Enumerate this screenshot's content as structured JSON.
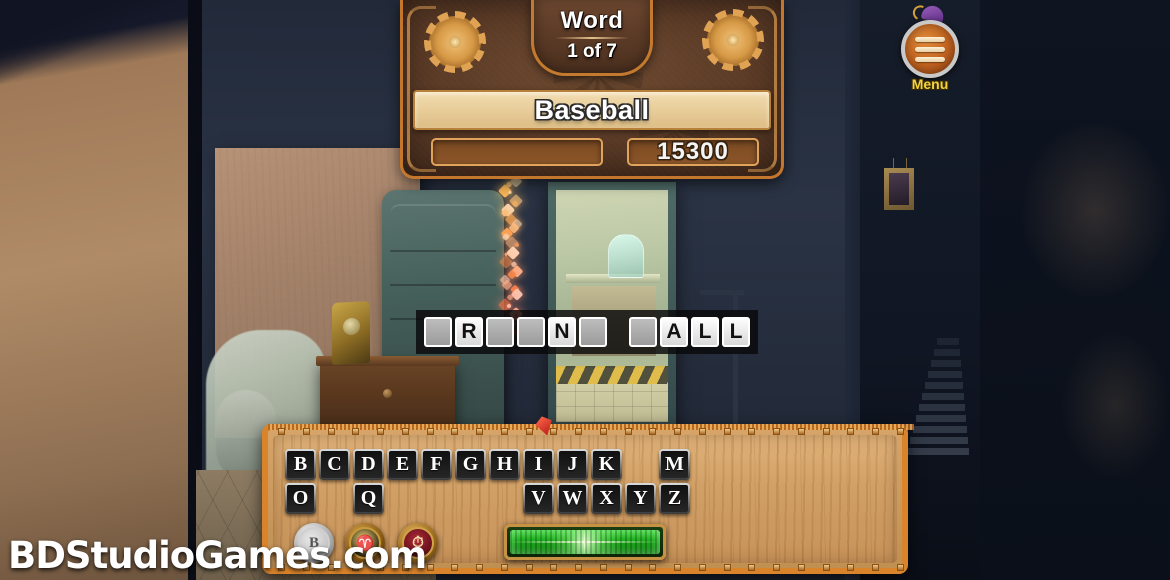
{
  "hud": {
    "word_title": "Word",
    "word_count": "1 of 7",
    "current_word": "Baseball",
    "score": "15300",
    "progress_percent": 0,
    "gear_left_icon": "gear-icon",
    "gear_right_icon": "gear-icon"
  },
  "menu": {
    "label": "Menu",
    "icon": "hamburger-menu-icon",
    "cap_icon": "wizard-hat-icon"
  },
  "answer": {
    "slots": [
      {
        "letter": "",
        "revealed": false
      },
      {
        "letter": "R",
        "revealed": true
      },
      {
        "letter": "",
        "revealed": false
      },
      {
        "letter": "",
        "revealed": false
      },
      {
        "letter": "N",
        "revealed": true
      },
      {
        "letter": "",
        "revealed": false
      },
      {
        "letter": " ",
        "revealed": true,
        "space": true
      },
      {
        "letter": "",
        "revealed": false
      },
      {
        "letter": "A",
        "revealed": true
      },
      {
        "letter": "L",
        "revealed": true
      },
      {
        "letter": "L",
        "revealed": true
      }
    ]
  },
  "keyboard": {
    "row1": [
      "B",
      "C",
      "D",
      "E",
      "F",
      "G",
      "H",
      "I",
      "J",
      "K",
      "",
      "M"
    ],
    "row2": [
      "O",
      "",
      "Q",
      "",
      "",
      "",
      "",
      "V",
      "W",
      "X",
      "Y",
      "Z"
    ],
    "gem_icon": "red-gem-icon"
  },
  "powerups": [
    {
      "name": "bomb-powerup",
      "glyph": "B"
    },
    {
      "name": "bell-powerup",
      "glyph": "♈"
    },
    {
      "name": "timer-powerup",
      "glyph": "⏱"
    }
  ],
  "energy_bar": {
    "name": "energy-meter",
    "fill_percent": 100,
    "color": "#28c828"
  },
  "watermark": {
    "text": "BDStudioGames.com"
  },
  "colors": {
    "frame_orange": "#d9832b",
    "panel_brown": "#5a3a26",
    "wood": "#d1a066",
    "score_text": "#f4f4f4",
    "menu_label": "#f2d53c",
    "energy_green": "#28c828"
  }
}
